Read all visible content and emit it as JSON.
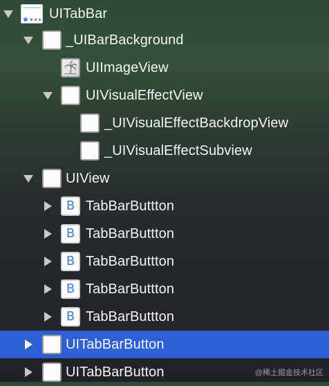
{
  "tree": {
    "nodes": [
      {
        "label": "UITabBar",
        "disclosure": "expanded",
        "icon": "tabbar-icon"
      },
      {
        "label": "_UIBarBackground",
        "disclosure": "expanded",
        "icon": "view-icon"
      },
      {
        "label": "UIImageView",
        "disclosure": "none",
        "icon": "image-view-icon"
      },
      {
        "label": "UIVisualEffectView",
        "disclosure": "expanded",
        "icon": "view-icon"
      },
      {
        "label": "_UIVisualEffectBackdropView",
        "disclosure": "none",
        "icon": "view-icon"
      },
      {
        "label": "_UIVisualEffectSubview",
        "disclosure": "none",
        "icon": "view-icon"
      },
      {
        "label": "UIView",
        "disclosure": "expanded",
        "icon": "view-icon"
      },
      {
        "label": "TabBarButtton",
        "disclosure": "collapsed",
        "icon": "button-icon",
        "icon_glyph": "B"
      },
      {
        "label": "TabBarButtton",
        "disclosure": "collapsed",
        "icon": "button-icon",
        "icon_glyph": "B"
      },
      {
        "label": "TabBarButtton",
        "disclosure": "collapsed",
        "icon": "button-icon",
        "icon_glyph": "B"
      },
      {
        "label": "TabBarButtton",
        "disclosure": "collapsed",
        "icon": "button-icon",
        "icon_glyph": "B"
      },
      {
        "label": "TabBarButtton",
        "disclosure": "collapsed",
        "icon": "button-icon",
        "icon_glyph": "B"
      },
      {
        "label": "UITabBarButton",
        "disclosure": "collapsed",
        "icon": "view-icon",
        "selected": true
      },
      {
        "label": "UITabBarButton",
        "disclosure": "collapsed",
        "icon": "view-icon"
      }
    ]
  },
  "watermark": "@稀土掘金技术社区",
  "colors": {
    "selection": "#2e5fd6",
    "background_top": "#34503a",
    "background_bottom": "#202326",
    "button_glyph": "#3a7bd5"
  }
}
